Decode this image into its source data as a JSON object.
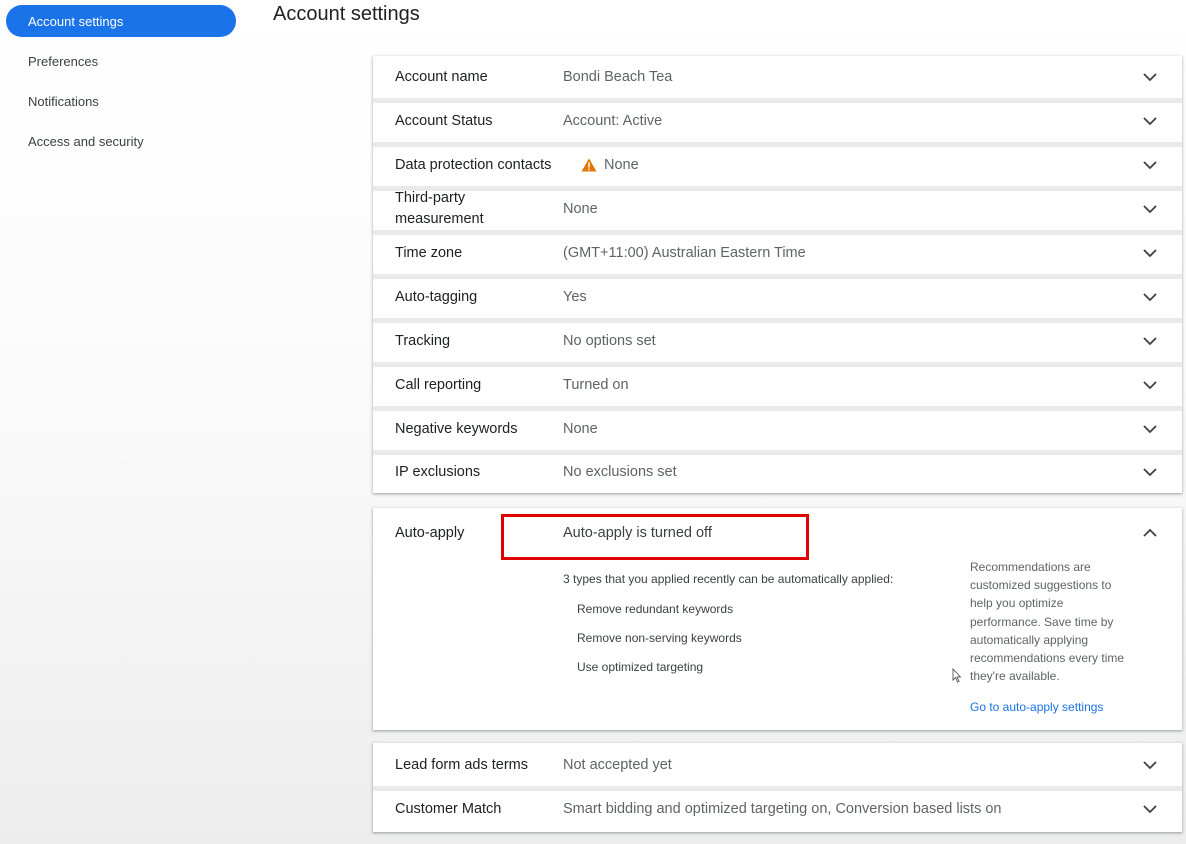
{
  "sidebar": {
    "items": [
      {
        "label": "Account settings",
        "active": true
      },
      {
        "label": "Preferences"
      },
      {
        "label": "Notifications"
      },
      {
        "label": "Access and security"
      }
    ]
  },
  "page": {
    "title": "Account settings"
  },
  "settings": [
    {
      "label": "Account name",
      "value": "Bondi Beach Tea"
    },
    {
      "label": "Account Status",
      "value": "Account: Active"
    },
    {
      "label": "Data protection contacts",
      "value": "None",
      "icon": "warning-icon"
    },
    {
      "label": "Third-party measurement",
      "value": "None"
    },
    {
      "label": "Time zone",
      "value": "(GMT+11:00) Australian Eastern Time"
    },
    {
      "label": "Auto-tagging",
      "value": "Yes"
    },
    {
      "label": "Tracking",
      "value": "No options set"
    },
    {
      "label": "Call reporting",
      "value": "Turned on"
    },
    {
      "label": "Negative keywords",
      "value": "None"
    },
    {
      "label": "IP exclusions",
      "value": "No exclusions set"
    }
  ],
  "auto_apply": {
    "label": "Auto-apply",
    "value": "Auto-apply is turned off",
    "intro": "3 types that you applied recently can be automatically applied:",
    "types": [
      "Remove redundant keywords",
      "Remove non-serving keywords",
      "Use optimized targeting"
    ],
    "help": "Recommendations are customized suggestions to help you optimize performance. Save time by automatically applying recommendations every time they're available.",
    "link": "Go to auto-apply settings"
  },
  "bottom_settings": [
    {
      "label": "Lead form ads terms",
      "value": "Not accepted yet"
    },
    {
      "label": "Customer Match",
      "value": "Smart bidding and optimized targeting on, Conversion based lists on"
    }
  ],
  "colors": {
    "accent": "#1a73e8",
    "warning": "#e37400",
    "highlight": "#e00000"
  }
}
